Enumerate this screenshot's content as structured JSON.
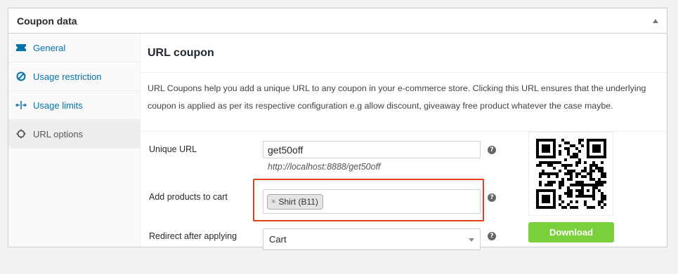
{
  "panel": {
    "title": "Coupon data"
  },
  "sidebar": {
    "items": [
      {
        "label": "General",
        "icon": "ticket-icon"
      },
      {
        "label": "Usage restriction",
        "icon": "ban-icon"
      },
      {
        "label": "Usage limits",
        "icon": "arrows-icon"
      },
      {
        "label": "URL options",
        "icon": "gear-icon"
      }
    ]
  },
  "main": {
    "title": "URL coupon",
    "description": "URL Coupons help you add a unique URL to any coupon in your e-commerce store. Clicking this URL ensures that the underlying coupon is applied as per its respective configuration e.g allow discount, giveaway free product whatever the case maybe."
  },
  "form": {
    "unique_url_label": "Unique URL",
    "unique_url_value": "get50off",
    "url_hint": "http://localhost:8888/get50off",
    "add_products_label": "Add products to cart",
    "product_chip": "Shirt (B11)",
    "chip_remove": "×",
    "redirect_label": "Redirect after applying",
    "redirect_value": "Cart",
    "help": "?"
  },
  "qr": {
    "download_label": "Download"
  },
  "colors": {
    "accent": "#0073aa",
    "download": "#7ad03a",
    "highlight": "#e2401c"
  }
}
